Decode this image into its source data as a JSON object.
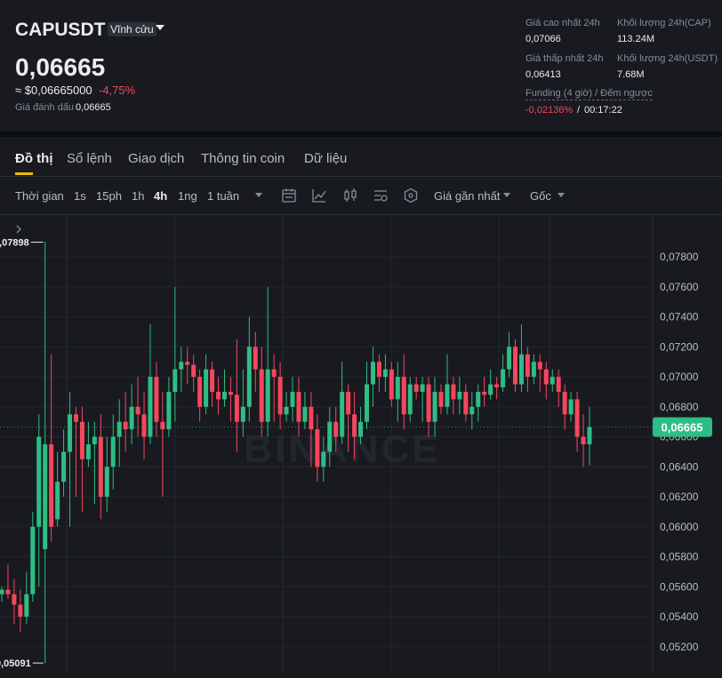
{
  "header": {
    "symbol": "CAPUSDT",
    "contract_type": "Vĩnh cửu",
    "last_price": "0,06665",
    "usd_price": "≈ $0,06665000",
    "change_pct": "-4,75%",
    "mark_label": "Giá đánh dấu",
    "mark_price": "0,06665",
    "high_label": "Giá cao nhất 24h",
    "high_value": "0,07066",
    "low_label": "Giá thấp nhất 24h",
    "low_value": "0,06413",
    "vol_cap_label": "Khối lượng 24h(CAP)",
    "vol_cap_value": "113.24M",
    "vol_usdt_label": "Khối lượng 24h(USDT)",
    "vol_usdt_value": "7.68M",
    "funding_label": "Funding (4 giờ) / Đếm ngược",
    "funding_rate": "-0,02136%",
    "funding_sep": "/",
    "countdown": "00:17:22"
  },
  "tabs": [
    "Đồ thị",
    "Sổ lệnh",
    "Giao dịch",
    "Thông tin coin",
    "Dữ liệu"
  ],
  "toolbar": {
    "time_label": "Thời gian",
    "intervals": [
      "1s",
      "15ph",
      "1h",
      "4h",
      "1ng",
      "1 tuần"
    ],
    "active_interval": "4h",
    "price_source": "Giá gần nhất",
    "scale_mode": "Gốc"
  },
  "colors": {
    "up": "#2ebd85",
    "down": "#f6465d",
    "accent": "#f0b90b",
    "background": "#181a20"
  },
  "chart_data": {
    "type": "candlestick",
    "watermark": "BINANCE",
    "y_ticks": [
      "0,07800",
      "0,07600",
      "0,07400",
      "0,07200",
      "0,07000",
      "0,06800",
      "0,06600",
      "0,06400",
      "0,06200",
      "0,06000",
      "0,05800",
      "0,05600",
      "0,05400",
      "0,05200"
    ],
    "y_range": [
      0.0508,
      0.0802
    ],
    "current_price": 0.06665,
    "current_price_label": "0,06665",
    "max_marker": {
      "value": 0.07898,
      "label": "0,07898"
    },
    "min_marker": {
      "value": 0.05091,
      "label": "0,05091"
    },
    "candles": [
      [
        0.0555,
        0.0558,
        0.055,
        0.056
      ],
      [
        0.0558,
        0.0555,
        0.0552,
        0.0575
      ],
      [
        0.0555,
        0.0548,
        0.0535,
        0.0565
      ],
      [
        0.0548,
        0.054,
        0.053,
        0.0558
      ],
      [
        0.054,
        0.0555,
        0.0535,
        0.057
      ],
      [
        0.0555,
        0.06,
        0.055,
        0.061
      ],
      [
        0.06,
        0.066,
        0.056,
        0.0675
      ],
      [
        0.0585,
        0.0655,
        0.0509,
        0.079
      ],
      [
        0.0655,
        0.06,
        0.059,
        0.0715
      ],
      [
        0.0605,
        0.063,
        0.06,
        0.065
      ],
      [
        0.063,
        0.065,
        0.062,
        0.0665
      ],
      [
        0.065,
        0.0675,
        0.06,
        0.069
      ],
      [
        0.0675,
        0.067,
        0.062,
        0.068
      ],
      [
        0.067,
        0.0645,
        0.061,
        0.068
      ],
      [
        0.0645,
        0.0655,
        0.064,
        0.067
      ],
      [
        0.0655,
        0.066,
        0.0615,
        0.067
      ],
      [
        0.066,
        0.062,
        0.0605,
        0.0675
      ],
      [
        0.062,
        0.064,
        0.061,
        0.066
      ],
      [
        0.064,
        0.066,
        0.0625,
        0.0675
      ],
      [
        0.066,
        0.067,
        0.064,
        0.0685
      ],
      [
        0.067,
        0.0665,
        0.065,
        0.069
      ],
      [
        0.0665,
        0.068,
        0.0655,
        0.0695
      ],
      [
        0.068,
        0.0675,
        0.066,
        0.07
      ],
      [
        0.0675,
        0.066,
        0.0645,
        0.069
      ],
      [
        0.066,
        0.07,
        0.0655,
        0.0735
      ],
      [
        0.07,
        0.067,
        0.066,
        0.071
      ],
      [
        0.067,
        0.0665,
        0.062,
        0.069
      ],
      [
        0.0665,
        0.069,
        0.066,
        0.07
      ],
      [
        0.069,
        0.0705,
        0.067,
        0.076
      ],
      [
        0.0705,
        0.071,
        0.069,
        0.072
      ],
      [
        0.071,
        0.0708,
        0.0695,
        0.072
      ],
      [
        0.0708,
        0.07,
        0.069,
        0.0715
      ],
      [
        0.07,
        0.068,
        0.067,
        0.0705
      ],
      [
        0.068,
        0.0705,
        0.0675,
        0.0715
      ],
      [
        0.0705,
        0.069,
        0.068,
        0.071
      ],
      [
        0.069,
        0.0685,
        0.0675,
        0.07
      ],
      [
        0.0685,
        0.069,
        0.068,
        0.0705
      ],
      [
        0.069,
        0.0688,
        0.067,
        0.07
      ],
      [
        0.0688,
        0.067,
        0.065,
        0.0725
      ],
      [
        0.067,
        0.068,
        0.066,
        0.0705
      ],
      [
        0.068,
        0.072,
        0.067,
        0.074
      ],
      [
        0.072,
        0.0705,
        0.069,
        0.073
      ],
      [
        0.0705,
        0.067,
        0.066,
        0.072
      ],
      [
        0.067,
        0.0705,
        0.066,
        0.076
      ],
      [
        0.0705,
        0.07,
        0.067,
        0.0715
      ],
      [
        0.07,
        0.0675,
        0.0665,
        0.071
      ],
      [
        0.0675,
        0.068,
        0.067,
        0.069
      ],
      [
        0.068,
        0.069,
        0.067,
        0.07
      ],
      [
        0.069,
        0.067,
        0.066,
        0.07
      ],
      [
        0.067,
        0.068,
        0.0665,
        0.069
      ],
      [
        0.068,
        0.0665,
        0.064,
        0.069
      ],
      [
        0.0665,
        0.064,
        0.063,
        0.0675
      ],
      [
        0.064,
        0.065,
        0.063,
        0.066
      ],
      [
        0.065,
        0.067,
        0.064,
        0.068
      ],
      [
        0.067,
        0.066,
        0.065,
        0.068
      ],
      [
        0.066,
        0.069,
        0.0655,
        0.071
      ],
      [
        0.069,
        0.0675,
        0.065,
        0.0695
      ],
      [
        0.0675,
        0.066,
        0.0645,
        0.069
      ],
      [
        0.066,
        0.067,
        0.0655,
        0.068
      ],
      [
        0.067,
        0.0695,
        0.0665,
        0.071
      ],
      [
        0.0695,
        0.071,
        0.068,
        0.072
      ],
      [
        0.071,
        0.07,
        0.069,
        0.0715
      ],
      [
        0.07,
        0.0705,
        0.069,
        0.0715
      ],
      [
        0.0705,
        0.0685,
        0.068,
        0.071
      ],
      [
        0.0685,
        0.07,
        0.067,
        0.071
      ],
      [
        0.07,
        0.0675,
        0.0665,
        0.0715
      ],
      [
        0.0675,
        0.0695,
        0.067,
        0.07
      ],
      [
        0.0695,
        0.069,
        0.0685,
        0.07
      ],
      [
        0.069,
        0.0695,
        0.067,
        0.07
      ],
      [
        0.0695,
        0.067,
        0.066,
        0.07
      ],
      [
        0.067,
        0.069,
        0.066,
        0.07
      ],
      [
        0.069,
        0.068,
        0.0675,
        0.0695
      ],
      [
        0.068,
        0.0695,
        0.0675,
        0.0715
      ],
      [
        0.0695,
        0.0685,
        0.0675,
        0.07
      ],
      [
        0.0685,
        0.069,
        0.0675,
        0.07
      ],
      [
        0.069,
        0.0675,
        0.067,
        0.0695
      ],
      [
        0.0675,
        0.068,
        0.0665,
        0.069
      ],
      [
        0.068,
        0.069,
        0.067,
        0.0695
      ],
      [
        0.069,
        0.0688,
        0.068,
        0.07
      ],
      [
        0.0688,
        0.0695,
        0.0685,
        0.0705
      ],
      [
        0.0695,
        0.0693,
        0.0685,
        0.07
      ],
      [
        0.0693,
        0.0705,
        0.069,
        0.0715
      ],
      [
        0.0705,
        0.072,
        0.07,
        0.073
      ],
      [
        0.072,
        0.0695,
        0.069,
        0.0725
      ],
      [
        0.0695,
        0.0715,
        0.069,
        0.0735
      ],
      [
        0.0715,
        0.07,
        0.069,
        0.072
      ],
      [
        0.07,
        0.071,
        0.0695,
        0.0715
      ],
      [
        0.071,
        0.0705,
        0.069,
        0.0715
      ],
      [
        0.0705,
        0.0695,
        0.0685,
        0.071
      ],
      [
        0.0695,
        0.07,
        0.069,
        0.0705
      ],
      [
        0.07,
        0.069,
        0.068,
        0.0705
      ],
      [
        0.069,
        0.0675,
        0.0665,
        0.0695
      ],
      [
        0.0675,
        0.0685,
        0.067,
        0.069
      ],
      [
        0.0685,
        0.066,
        0.065,
        0.069
      ],
      [
        0.066,
        0.0655,
        0.064,
        0.0675
      ],
      [
        0.0655,
        0.06665,
        0.0641,
        0.068
      ]
    ]
  }
}
